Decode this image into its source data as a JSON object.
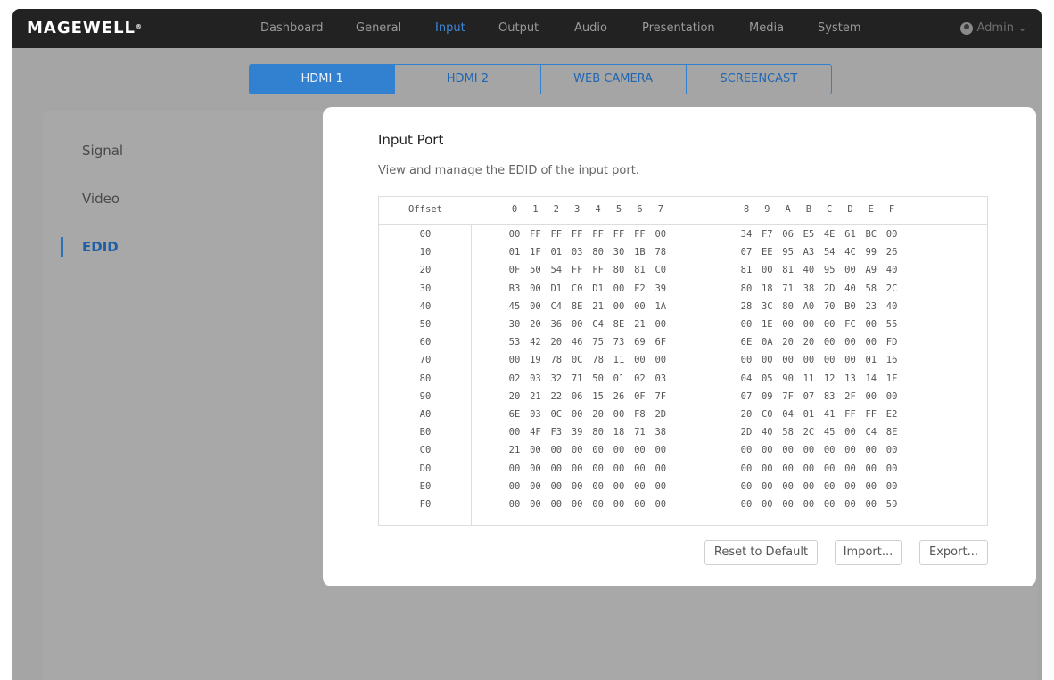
{
  "app": {
    "logo": "MAGEWELL",
    "logo_mark": "®",
    "nav": [
      "Dashboard",
      "General",
      "Input",
      "Output",
      "Audio",
      "Presentation",
      "Media",
      "System"
    ],
    "active_nav": "Input",
    "user": "Admin",
    "user_caret": "⌄",
    "accent_color": "#3280d0"
  },
  "input_tabs": {
    "items": [
      "HDMI 1",
      "HDMI 2",
      "WEB CAMERA",
      "SCREENCAST"
    ],
    "active": "HDMI 1"
  },
  "sidebar": {
    "items": [
      "Signal",
      "Video",
      "EDID"
    ],
    "active": "EDID"
  },
  "edid": {
    "title": "Input Port",
    "description": "View and manage the EDID of the input port.",
    "offset_header": "Offset",
    "columns": [
      "0",
      "1",
      "2",
      "3",
      "4",
      "5",
      "6",
      "7",
      "8",
      "9",
      "A",
      "B",
      "C",
      "D",
      "E",
      "F"
    ],
    "rows": [
      {
        "offset": "00",
        "bytes": [
          "00",
          "FF",
          "FF",
          "FF",
          "FF",
          "FF",
          "FF",
          "00",
          "34",
          "F7",
          "06",
          "E5",
          "4E",
          "61",
          "BC",
          "00"
        ]
      },
      {
        "offset": "10",
        "bytes": [
          "01",
          "1F",
          "01",
          "03",
          "80",
          "30",
          "1B",
          "78",
          "07",
          "EE",
          "95",
          "A3",
          "54",
          "4C",
          "99",
          "26"
        ]
      },
      {
        "offset": "20",
        "bytes": [
          "0F",
          "50",
          "54",
          "FF",
          "FF",
          "80",
          "81",
          "C0",
          "81",
          "00",
          "81",
          "40",
          "95",
          "00",
          "A9",
          "40"
        ]
      },
      {
        "offset": "30",
        "bytes": [
          "B3",
          "00",
          "D1",
          "C0",
          "D1",
          "00",
          "F2",
          "39",
          "80",
          "18",
          "71",
          "38",
          "2D",
          "40",
          "58",
          "2C"
        ]
      },
      {
        "offset": "40",
        "bytes": [
          "45",
          "00",
          "C4",
          "8E",
          "21",
          "00",
          "00",
          "1A",
          "28",
          "3C",
          "80",
          "A0",
          "70",
          "B0",
          "23",
          "40"
        ]
      },
      {
        "offset": "50",
        "bytes": [
          "30",
          "20",
          "36",
          "00",
          "C4",
          "8E",
          "21",
          "00",
          "00",
          "1E",
          "00",
          "00",
          "00",
          "FC",
          "00",
          "55"
        ]
      },
      {
        "offset": "60",
        "bytes": [
          "53",
          "42",
          "20",
          "46",
          "75",
          "73",
          "69",
          "6F",
          "6E",
          "0A",
          "20",
          "20",
          "00",
          "00",
          "00",
          "FD"
        ]
      },
      {
        "offset": "70",
        "bytes": [
          "00",
          "19",
          "78",
          "0C",
          "78",
          "11",
          "00",
          "00",
          "00",
          "00",
          "00",
          "00",
          "00",
          "00",
          "01",
          "16"
        ]
      },
      {
        "offset": "80",
        "bytes": [
          "02",
          "03",
          "32",
          "71",
          "50",
          "01",
          "02",
          "03",
          "04",
          "05",
          "90",
          "11",
          "12",
          "13",
          "14",
          "1F"
        ]
      },
      {
        "offset": "90",
        "bytes": [
          "20",
          "21",
          "22",
          "06",
          "15",
          "26",
          "0F",
          "7F",
          "07",
          "09",
          "7F",
          "07",
          "83",
          "2F",
          "00",
          "00"
        ]
      },
      {
        "offset": "A0",
        "bytes": [
          "6E",
          "03",
          "0C",
          "00",
          "20",
          "00",
          "F8",
          "2D",
          "20",
          "C0",
          "04",
          "01",
          "41",
          "FF",
          "FF",
          "E2"
        ]
      },
      {
        "offset": "B0",
        "bytes": [
          "00",
          "4F",
          "F3",
          "39",
          "80",
          "18",
          "71",
          "38",
          "2D",
          "40",
          "58",
          "2C",
          "45",
          "00",
          "C4",
          "8E"
        ]
      },
      {
        "offset": "C0",
        "bytes": [
          "21",
          "00",
          "00",
          "00",
          "00",
          "00",
          "00",
          "00",
          "00",
          "00",
          "00",
          "00",
          "00",
          "00",
          "00",
          "00"
        ]
      },
      {
        "offset": "D0",
        "bytes": [
          "00",
          "00",
          "00",
          "00",
          "00",
          "00",
          "00",
          "00",
          "00",
          "00",
          "00",
          "00",
          "00",
          "00",
          "00",
          "00"
        ]
      },
      {
        "offset": "E0",
        "bytes": [
          "00",
          "00",
          "00",
          "00",
          "00",
          "00",
          "00",
          "00",
          "00",
          "00",
          "00",
          "00",
          "00",
          "00",
          "00",
          "00"
        ]
      },
      {
        "offset": "F0",
        "bytes": [
          "00",
          "00",
          "00",
          "00",
          "00",
          "00",
          "00",
          "00",
          "00",
          "00",
          "00",
          "00",
          "00",
          "00",
          "00",
          "59"
        ]
      }
    ]
  },
  "actions": {
    "reset": "Reset to Default",
    "import": "Import...",
    "export": "Export..."
  }
}
